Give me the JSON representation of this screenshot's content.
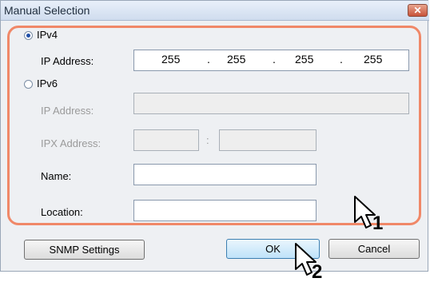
{
  "window": {
    "title": "Manual Selection",
    "close_glyph": "✕"
  },
  "ipv4": {
    "label": "IPv4",
    "selected": true,
    "ip_label": "IP Address:",
    "octets": [
      "255",
      "255",
      "255",
      "255"
    ],
    "separator": "."
  },
  "ipv6": {
    "label": "IPv6",
    "selected": false,
    "ip_label": "IP Address:",
    "ipx_label": "IPX Address:",
    "ipx_separator": ":"
  },
  "name": {
    "label": "Name:",
    "value": ""
  },
  "location": {
    "label": "Location:",
    "value": ""
  },
  "buttons": {
    "snmp": "SNMP Settings",
    "ok": "OK",
    "cancel": "Cancel"
  },
  "annotations": {
    "marker1": "1",
    "marker2": "2",
    "highlight_color": "#f08868"
  }
}
